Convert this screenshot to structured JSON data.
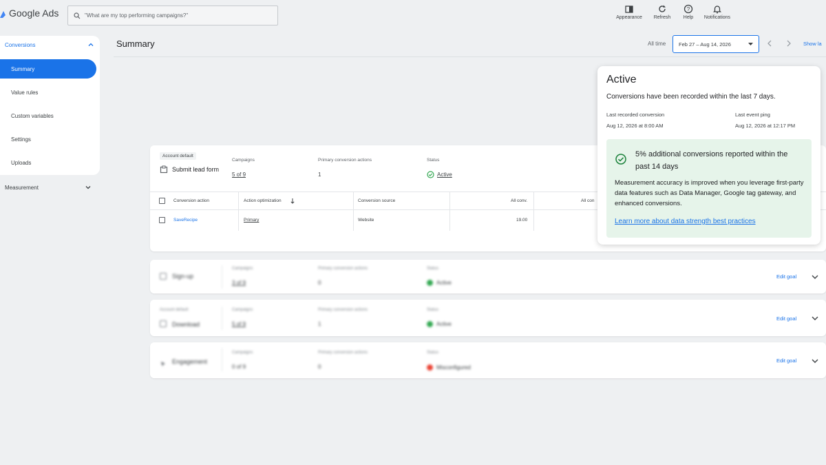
{
  "app": {
    "logo_text": "Google Ads",
    "search_placeholder": "\"What are my top performing campaigns?\"",
    "tools": [
      {
        "label": "Appearance",
        "icon": "appearance-icon"
      },
      {
        "label": "Refresh",
        "icon": "refresh-icon"
      },
      {
        "label": "Help",
        "icon": "help-icon"
      },
      {
        "label": "Notifications",
        "icon": "bell-icon"
      }
    ]
  },
  "sidebar": {
    "section_label": "Conversions",
    "items": [
      {
        "label": "Summary",
        "active": true
      },
      {
        "label": "Value rules",
        "active": false
      },
      {
        "label": "Custom variables",
        "active": false
      },
      {
        "label": "Settings",
        "active": false
      },
      {
        "label": "Uploads",
        "active": false
      }
    ],
    "measurement_label": "Measurement"
  },
  "header": {
    "title": "Summary",
    "all_time": "All time",
    "date_range": "Feb 27 – Aug 14, 2026",
    "show_link": "Show la"
  },
  "goal": {
    "badge": "Account default",
    "name": "Submit lead form",
    "campaigns_label": "Campaigns",
    "campaigns_value": "5 of 9",
    "primary_label": "Primary conversion actions",
    "primary_value": "1",
    "status_label": "Status",
    "status_value": "Active",
    "table": {
      "headers": [
        "Conversion action",
        "Action optimization",
        "Conversion source",
        "All conv.",
        "All con"
      ],
      "rows": [
        {
          "action": "SaveRecipe",
          "optimization": "Primary",
          "source": "Website",
          "all_conv": "19.00"
        }
      ]
    }
  },
  "other_goals": [
    {
      "badge": "",
      "name": "Sign-up",
      "campaigns_label": "Campaigns",
      "campaigns_value": "3 of 9",
      "primary_label": "Primary conversion actions",
      "primary_value": "0",
      "status_label": "Status",
      "status_value": "Active",
      "edit": "Edit goal"
    },
    {
      "badge": "Account default",
      "name": "Download",
      "campaigns_label": "Campaigns",
      "campaigns_value": "5 of 9",
      "primary_label": "Primary conversion actions",
      "primary_value": "1",
      "status_label": "Status",
      "status_value": "Active",
      "edit": "Edit goal"
    },
    {
      "badge": "",
      "name": "Engagement",
      "campaigns_label": "Campaigns",
      "campaigns_value": "0 of 9",
      "primary_label": "Primary conversion actions",
      "primary_value": "0",
      "status_label": "Status",
      "status_value": "Misconfigured",
      "edit": "Edit goal"
    }
  ],
  "popover": {
    "title": "Active",
    "description": "Conversions have been recorded within the last 7 days.",
    "last_conv_label": "Last recorded conversion",
    "last_conv_value": "Aug 12, 2026 at 8:00 AM",
    "last_ping_label": "Last event ping",
    "last_ping_value": "Aug 12, 2026 at 12:17 PM",
    "highlight_title": "5% additional conversions reported within the past 14 days",
    "highlight_body": "Measurement accuracy is improved when you leverage first-party data features such as Data Manager, Google tag gateway, and enhanced conversions.",
    "highlight_link": "Learn more about data strength best practices"
  },
  "colors": {
    "accent": "#1a73e8",
    "success": "#34a853",
    "success_bg": "#e6f4ea",
    "error": "#ea4335"
  }
}
